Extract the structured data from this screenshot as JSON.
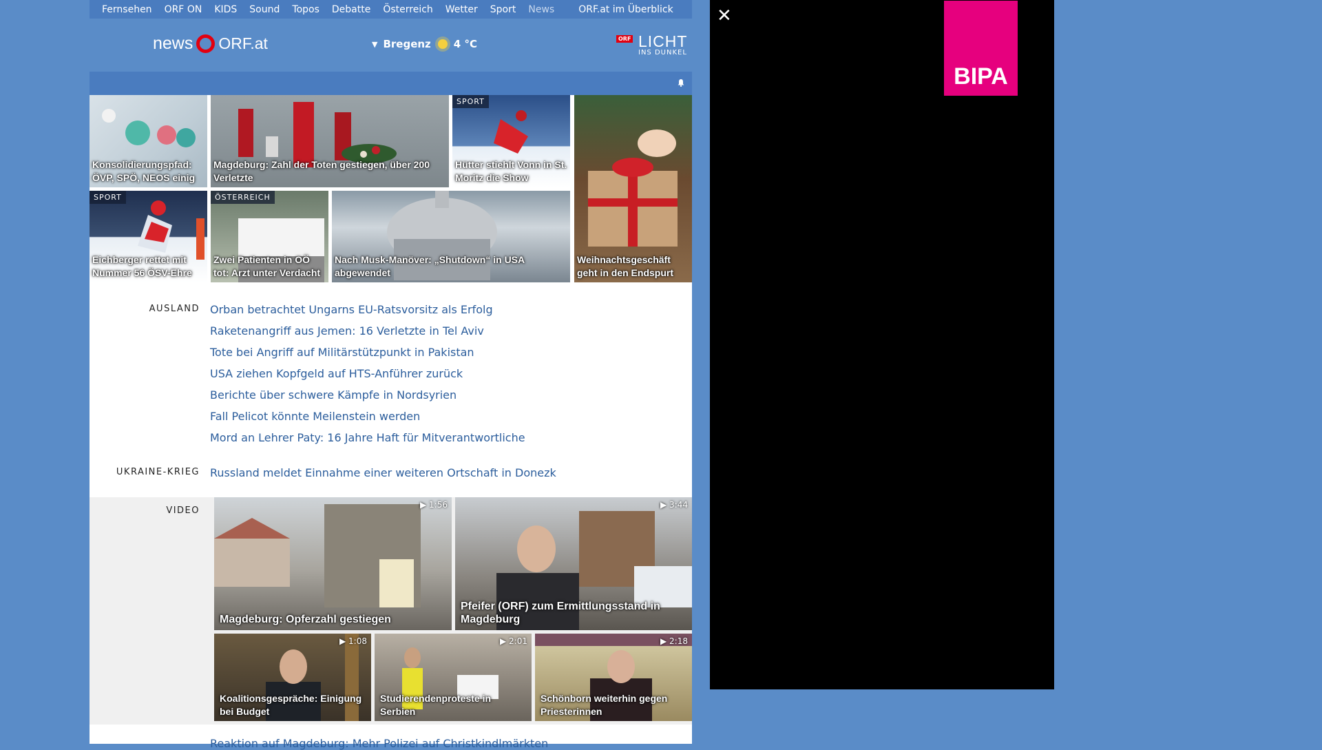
{
  "topnav": {
    "items": [
      "Fernsehen",
      "ORF ON",
      "KIDS",
      "Sound",
      "Topos",
      "Debatte",
      "Österreich",
      "Wetter",
      "Sport",
      "News"
    ],
    "overview": "ORF.at im Überblick"
  },
  "header": {
    "logo_news": "news",
    "logo_orf": "ORF.at",
    "weather_location": "Bregenz",
    "weather_temp": "4 °C",
    "licht_badge": "ORF",
    "licht_big": "LICHT",
    "licht_small": "INS DUNKEL"
  },
  "tiles": [
    {
      "caption": "Konsolidierungspfad: ÖVP, SPÖ, NEOS einig",
      "tag": ""
    },
    {
      "caption": "Magdeburg: Zahl der Toten gestiegen, über 200 Verletzte",
      "tag": ""
    },
    {
      "caption": "Hütter stiehlt Vonn in St. Moritz die Show",
      "tag": "SPORT"
    },
    {
      "caption": "Weihnachtsgeschäft geht in den Endspurt",
      "tag": ""
    },
    {
      "caption": "Eichberger rettet mit Nummer 56 ÖSV-Ehre",
      "tag": "SPORT"
    },
    {
      "caption": "Zwei Patienten in OÖ tot: Arzt unter Verdacht",
      "tag": "ÖSTERREICH"
    },
    {
      "caption": "Nach Musk-Manöver: „Shutdown“ in USA abgewendet",
      "tag": ""
    }
  ],
  "ausland": {
    "label": "AUSLAND",
    "links": [
      "Orban betrachtet Ungarns EU-Ratsvorsitz als Erfolg",
      "Raketenangriff aus Jemen: 16 Verletzte in Tel Aviv",
      "Tote bei Angriff auf Militärstützpunkt in Pakistan",
      "USA ziehen Kopfgeld auf HTS-Anführer zurück",
      "Berichte über schwere Kämpfe in Nordsyrien",
      "Fall Pelicot könnte Meilenstein werden",
      "Mord an Lehrer Paty: 16 Jahre Haft für Mitverantwortliche"
    ]
  },
  "ukraine": {
    "label": "UKRAINE-KRIEG",
    "links": [
      "Russland meldet Einnahme einer weiteren Ortschaft in Donezk"
    ]
  },
  "video": {
    "label": "VIDEO",
    "items": [
      {
        "caption": "Magdeburg: Opferzahl gestiegen",
        "duration": "▶ 1:56"
      },
      {
        "caption": "Pfeifer (ORF) zum Ermittlungsstand in Magdeburg",
        "duration": "▶ 3:44"
      },
      {
        "caption": "Koalitionsgespräche: Einigung bei Budget",
        "duration": "▶ 1:08"
      },
      {
        "caption": "Studierendenproteste in Serbien",
        "duration": "▶ 2:01"
      },
      {
        "caption": "Schönborn weiterhin gegen Priesterinnen",
        "duration": "▶ 2:18"
      }
    ]
  },
  "bottom_partial": "Reaktion auf Magdeburg: Mehr Polizei auf Christkindlmärkten",
  "ad": {
    "close": "✕",
    "brand": "BIPA"
  },
  "colors": {
    "background": "#5a8cc8",
    "nav": "#4a7cbf",
    "link": "#2b5d9c",
    "orf_red": "#e3000f",
    "bipa_pink": "#e6007e"
  }
}
